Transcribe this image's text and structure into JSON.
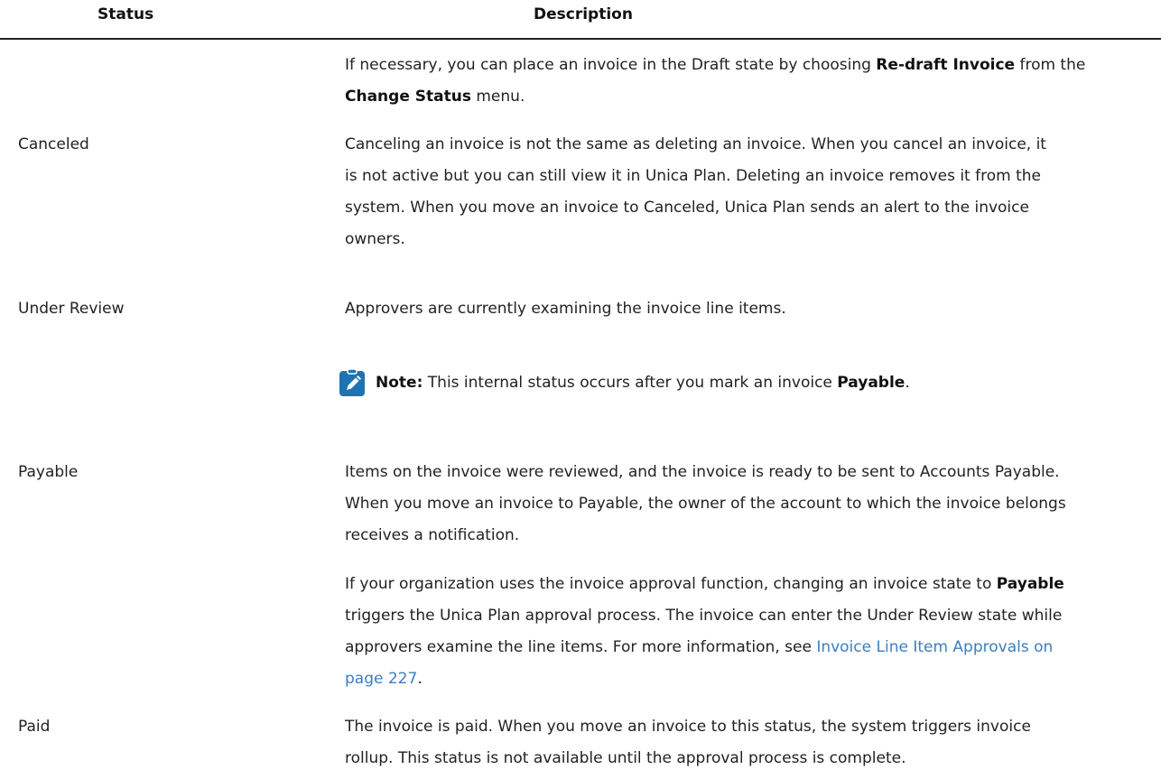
{
  "table": {
    "headers": {
      "status": "Status",
      "description": "Description"
    }
  },
  "rows": {
    "continued": {
      "line1_text": "If necessary, you can place an invoice in the Draft state by choosing ",
      "line1_bold": "Re-draft Invoice",
      "line1_end": " from the",
      "line2_bold": "Change Status",
      "line2_end": " menu."
    },
    "canceled": {
      "status": "Canceled",
      "lines": [
        "Canceling an invoice is not the same as deleting an invoice. When you cancel an invoice, it",
        "is not active but you can still view it in Unica Plan. Deleting an invoice removes it from the",
        "system. When you move an invoice to Canceled, Unica Plan sends an alert to the invoice",
        "owners."
      ]
    },
    "under_review": {
      "status": "Under Review",
      "line": "Approvers are currently examining the invoice line items.",
      "note": {
        "icon": "pencil-note-icon",
        "label": "Note:",
        "text": " This internal status occurs after you mark an invoice ",
        "bold": "Payable",
        "end": "."
      }
    },
    "payable": {
      "status": "Payable",
      "para1": [
        "Items on the invoice were reviewed, and the invoice is ready to be sent to Accounts Payable.",
        "When you move an invoice to Payable, the owner of the account to which the invoice belongs",
        "receives a notification."
      ],
      "para2": {
        "line1_text": "If your organization uses the invoice approval function, changing an invoice state to ",
        "line1_bold": "Payable",
        "line2": "triggers the Unica Plan approval process. The invoice can enter the Under Review state while",
        "line3_text": "approvers examine the line items. For more information, see ",
        "link_part1": "Invoice Line Item Approvals on",
        "link_part2": "page 227",
        "line4_end": "."
      }
    },
    "paid": {
      "status": "Paid",
      "lines": [
        "The invoice is paid. When you move an invoice to this status, the system triggers invoice",
        "rollup. This status is not available until the approval process is complete."
      ]
    }
  },
  "colors": {
    "link": "#3b7fc4",
    "note_icon": "#1e73b3"
  }
}
